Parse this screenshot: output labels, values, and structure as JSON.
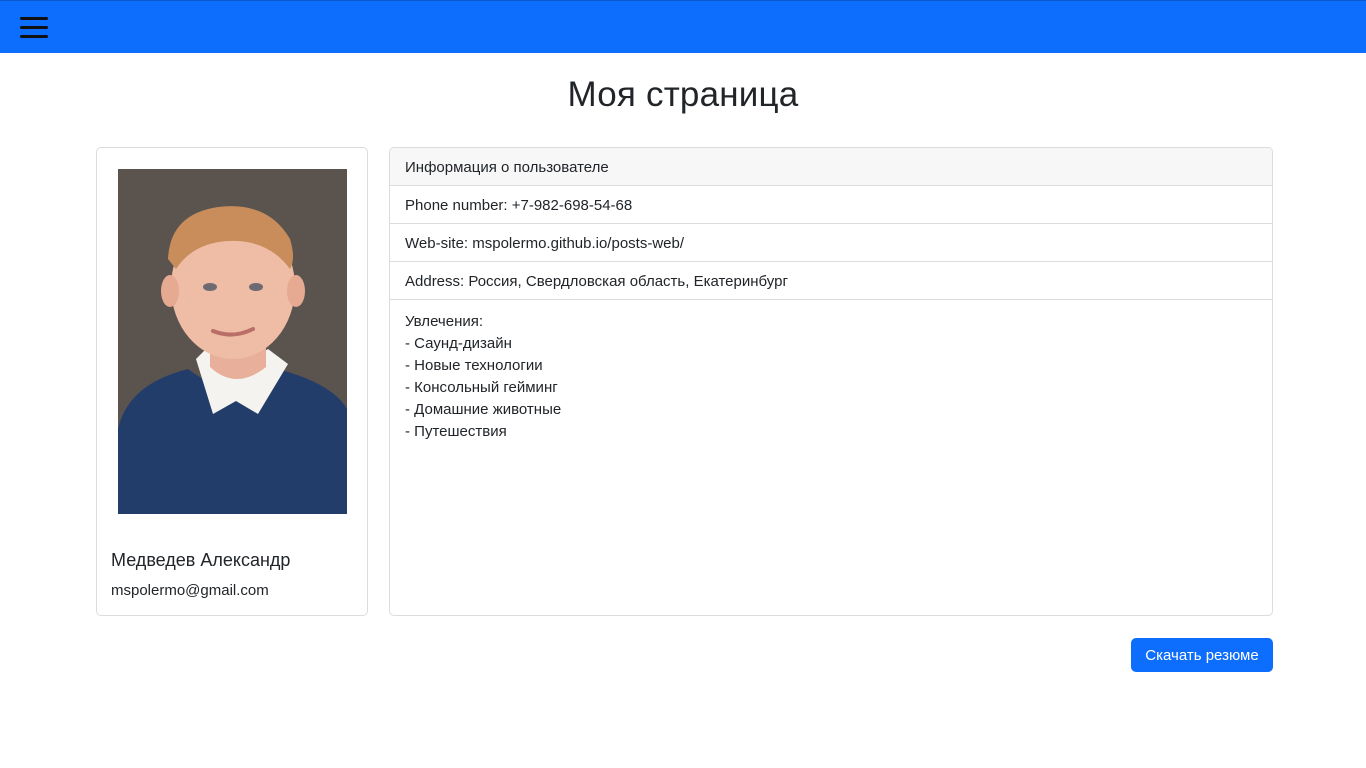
{
  "navbar": {
    "menu_icon": "hamburger-menu-icon",
    "color": "#0d6efd"
  },
  "page": {
    "title": "Моя страница"
  },
  "profile": {
    "name": "Медведев Александр",
    "email": "mspolermo@gmail.com"
  },
  "info": {
    "header": "Информация о пользователе",
    "phone": "Phone number: +7-982-698-54-68",
    "website": "Web-site: mspolermo.github.io/posts-web/",
    "address": "Address: Россия, Свердловская область, Екатеринбург",
    "hobbies_title": "Увлечения:",
    "hobbies": [
      "- Саунд-дизайн",
      "- Новые технологии",
      "- Консольный гейминг",
      "- Домашние животные",
      "- Путешествия"
    ]
  },
  "actions": {
    "download_label": "Скачать резюме",
    "accent": "#0d6efd"
  }
}
